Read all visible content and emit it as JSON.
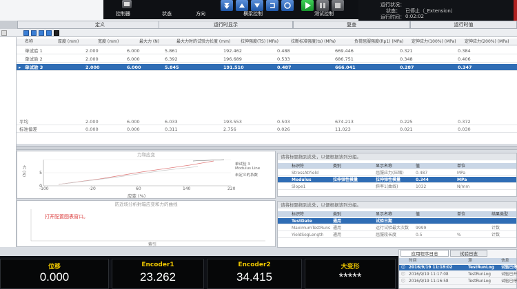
{
  "toolbar_top": {
    "controller_label": "控制器",
    "status_label": "状态",
    "direction_label": "方向",
    "beam_control_label": "横梁控制",
    "test_control_label": "测试控制",
    "status_line1_label": "运行状况：",
    "status_line2_label": "状态：",
    "status_line2_value": "已停止（_Extension）",
    "status_line3_label": "运行时间：",
    "status_line3_value": "0:02:02"
  },
  "tabs": [
    {
      "label": "定义"
    },
    {
      "label": "运行时显示"
    },
    {
      "label": "复查"
    },
    {
      "label": "运行时值"
    }
  ],
  "grid": {
    "headers": [
      "名称",
      "厚度 (mm)",
      "宽度 (mm)",
      "最大力 (N)",
      "最大力时的试验力长度 (mm)",
      "拉伸强度(TS) (MPa)",
      "拉断标准强度(ts) (MPa)",
      "负荷屈服强度(Rp1) (MPa)",
      "定伸应力(100%) (MPa)",
      "定伸应力(200%) (MPa)"
    ],
    "rows": [
      {
        "cells": [
          "单试验 1",
          "2.000",
          "6.000",
          "5.861",
          "192.462",
          "0.488",
          "669.446",
          "0.321",
          "0.384"
        ]
      },
      {
        "cells": [
          "单试验 2",
          "2.000",
          "6.000",
          "6.392",
          "196.689",
          "0.533",
          "686.751",
          "0.348",
          "0.406"
        ]
      },
      {
        "cells": [
          "单试验 3",
          "2.000",
          "6.000",
          "5.845",
          "191.510",
          "0.487",
          "666.041",
          "0.287",
          "0.347"
        ]
      }
    ],
    "summary": [
      {
        "cells": [
          "平均",
          "2.000",
          "6.000",
          "6.033",
          "193.553",
          "0.503",
          "674.213",
          "0.225",
          "0.372"
        ]
      },
      {
        "cells": [
          "标准偏差",
          "0.000",
          "0.000",
          "0.311",
          "2.756",
          "0.026",
          "11.023",
          "0.021",
          "0.030"
        ]
      }
    ]
  },
  "chart1": {
    "title": "力和应变",
    "ylabel": "力 (N)",
    "xlabel": "应变 (%)",
    "x_ticks": [
      "-100",
      "-20",
      "60",
      "140",
      "220"
    ],
    "legend": [
      "单试验 3",
      "Modulus Line",
      "未定义的系数"
    ]
  },
  "chart2": {
    "title": "防近场分析射箱应变和力的曲线",
    "message": "打开配置图表窗口。",
    "xlabel": "索引"
  },
  "props1": {
    "header": "请将标题拖到此处，以便根据该列分组。",
    "columns": [
      "标识符",
      "类别",
      "显示名称",
      "值",
      "单位"
    ],
    "rows": [
      {
        "cells": [
          "StressAtYield",
          "",
          "屈服应力(压缩)",
          "0.487",
          "MPa"
        ]
      },
      {
        "cells": [
          "Modulus",
          "拉伸弹性模量",
          "拉伸弹性模量",
          "0.344",
          "MPa"
        ]
      },
      {
        "cells": [
          "Slope1",
          "",
          "斜率1(曲线)",
          "1032",
          "N/mm"
        ]
      }
    ]
  },
  "props2": {
    "header": "请将标题拖到此处，以便根据该列分组。",
    "columns": [
      "标识符",
      "类别",
      "显示名称",
      "值",
      "单位",
      "结果类型"
    ],
    "rows": [
      {
        "cells": [
          "TestDate",
          "通用",
          "试验日期",
          "",
          "",
          ""
        ]
      },
      {
        "cells": [
          "MaximumTestRuns",
          "通用",
          "运行试验最大次数",
          "9999",
          "",
          "计数"
        ]
      },
      {
        "cells": [
          "YieldSegLength",
          "通用",
          "屈服段长度",
          "0.5",
          "%",
          "计数"
        ]
      }
    ]
  },
  "meters": [
    {
      "label": "位移",
      "value": "0.000"
    },
    {
      "label": "Encoder1",
      "value": "23.262"
    },
    {
      "label": "Encoder2",
      "value": "34.415"
    },
    {
      "label": "大变形",
      "value": "*****"
    }
  ],
  "log": {
    "tabs": [
      "应用程序日志",
      "试验日志"
    ],
    "columns": [
      "时间",
      "源",
      "信息"
    ],
    "rows": [
      {
        "cells": [
          "2016/9/19 11:18:02",
          "TestRunLog",
          "试验已停止"
        ]
      },
      {
        "cells": [
          "2016/9/19 11:17:08",
          "TestRunLog",
          "试验已开始"
        ]
      },
      {
        "cells": [
          "2016/9/19 11:16:58",
          "TestRunLog",
          "试验已停止"
        ]
      }
    ]
  }
}
